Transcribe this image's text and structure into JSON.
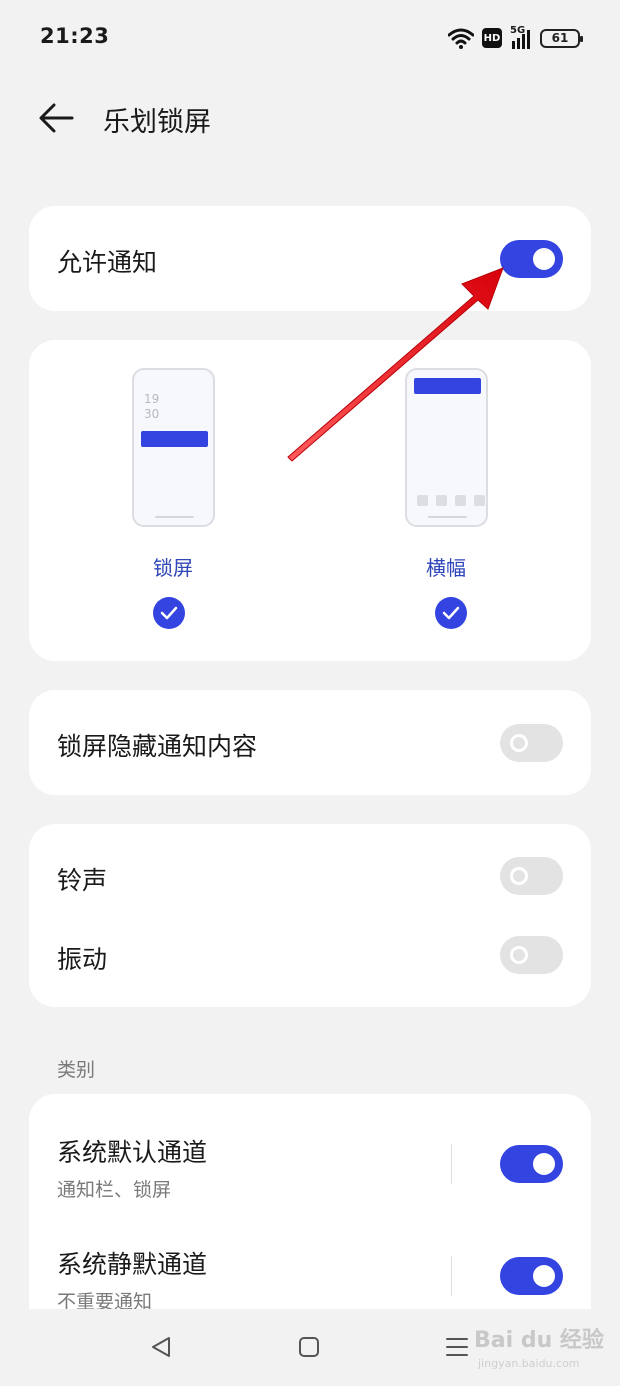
{
  "status_bar": {
    "time": "21:23",
    "hd_label": "HD",
    "network_label": "5G",
    "battery_level": "61"
  },
  "header": {
    "title": "乐划锁屏"
  },
  "allow_notifications": {
    "label": "允许通知",
    "enabled": true
  },
  "styles": {
    "lock_screen": {
      "label": "锁屏",
      "clock_hour": "19",
      "clock_minute": "30",
      "checked": true
    },
    "banner": {
      "label": "横幅",
      "checked": true
    }
  },
  "hide_content": {
    "label": "锁屏隐藏通知内容",
    "enabled": false
  },
  "sound_settings": {
    "ringtone_label": "铃声",
    "ringtone_enabled": false,
    "vibration_label": "振动",
    "vibration_enabled": false
  },
  "categories": {
    "section_label": "类别",
    "items": [
      {
        "title": "系统默认通道",
        "subtitle": "通知栏、锁屏",
        "enabled": true
      },
      {
        "title": "系统静默通道",
        "subtitle": "不重要通知",
        "enabled": true
      }
    ]
  },
  "watermark": {
    "text": "Bai du 经验",
    "sub": "jingyan.baidu.com"
  },
  "colors": {
    "accent": "#3344e0",
    "annotation_arrow": "#e8141c",
    "background": "#f2f2f2"
  }
}
